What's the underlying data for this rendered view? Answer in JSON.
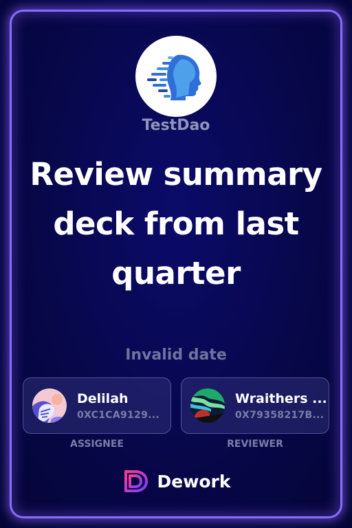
{
  "dao": {
    "name": "TestDao"
  },
  "task": {
    "title": "Review summary deck from last quarter",
    "date": "Invalid date"
  },
  "assignee": {
    "name": "Delilah",
    "address": "0XC1CA9129...",
    "role_label": "ASSIGNEE"
  },
  "reviewer": {
    "name": "Wraithers ...",
    "address": "0X79358217B...",
    "role_label": "REVIEWER"
  },
  "brand": {
    "name": "Dework"
  },
  "colors": {
    "frame_glow": "#8a6cff",
    "background": "#07074a",
    "brand_gradient_start": "#ff3d8b",
    "brand_gradient_end": "#7a3dff"
  },
  "icons": {
    "dao_logo": "digital-face-icon",
    "brand_logo": "dework-logo-icon"
  }
}
